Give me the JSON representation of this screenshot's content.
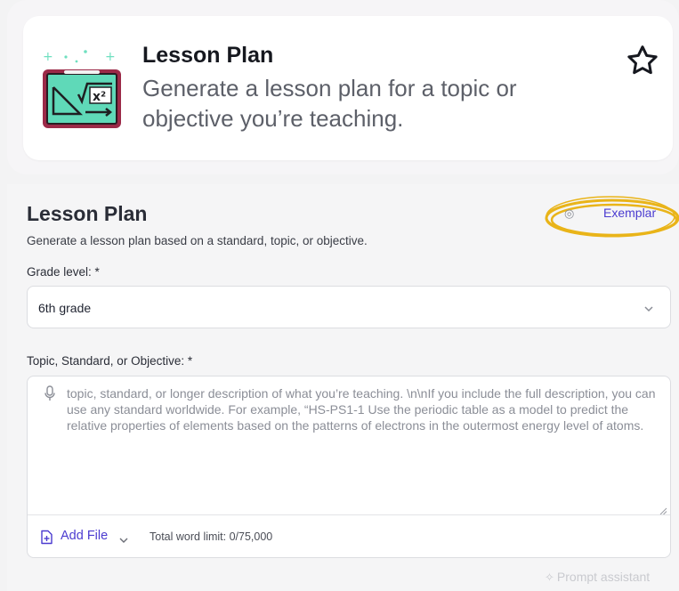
{
  "tool_card": {
    "title": "Lesson Plan",
    "description": "Generate a lesson plan for a topic or objective you’re teaching.",
    "icon": "math-chalkboard-icon",
    "favorite_icon": "star-outline-icon"
  },
  "form": {
    "title": "Lesson Plan",
    "subtitle": "Generate a lesson plan based on a standard, topic, or objective.",
    "exemplar_label": "Exemplar",
    "grade": {
      "label": "Grade level:  *",
      "value": "6th grade"
    },
    "topic": {
      "label": "Topic, Standard, or Objective:  *",
      "placeholder": "topic, standard, or longer description of what you’re teaching.  \\n\\nIf you include the full description, you can use any standard worldwide.  For example, “HS-PS1-1 Use the periodic table as a model to predict the relative properties of elements based on the patterns of electrons in the outermost energy level of atoms.",
      "add_file_label": "Add File",
      "word_limit": "Total word limit: 0/75,000"
    },
    "prompt_assistant_label": "Prompt assistant"
  },
  "colors": {
    "accent": "#4b3bd0",
    "highlight_scribble": "#e9b419",
    "icon_frame": "#9b2a48",
    "icon_board": "#5fd9b8"
  }
}
